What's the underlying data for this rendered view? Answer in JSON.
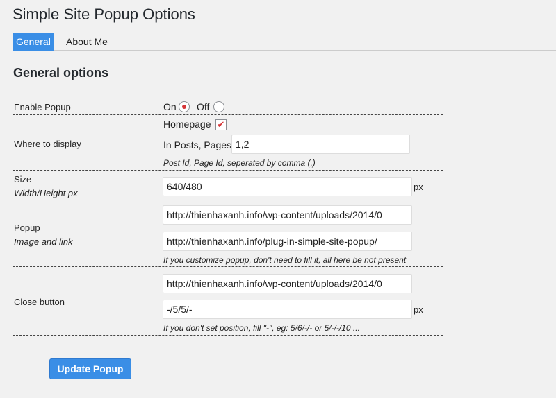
{
  "page": {
    "title": "Simple Site Popup Options"
  },
  "tabs": [
    {
      "label": "General",
      "active": true
    },
    {
      "label": "About Me",
      "active": false
    }
  ],
  "section": {
    "title": "General options"
  },
  "enable_popup": {
    "label": "Enable Popup",
    "on_label": "On",
    "off_label": "Off",
    "selected": "On"
  },
  "where": {
    "label": "Where to display",
    "homepage_label": "Homepage",
    "homepage_checked": true,
    "posts_label": "In Posts, Pages",
    "posts_value": "1,2",
    "note": "Post Id, Page Id, seperated by comma (,)"
  },
  "size": {
    "label": "Size",
    "sublabel": "Width/Height px",
    "value": "640/480",
    "unit": "px"
  },
  "popup": {
    "label": "Popup",
    "sublabel": "Image and link",
    "image_value": "http://thienhaxanh.info/wp-content/uploads/2014/0",
    "link_value": "http://thienhaxanh.info/plug-in-simple-site-popup/",
    "note": "If you customize popup, don't need to fill it, all here be not present"
  },
  "close_button": {
    "label": "Close button",
    "image_value": "http://thienhaxanh.info/wp-content/uploads/2014/0",
    "position_value": "-/5/5/-",
    "unit": "px",
    "note": "If you don't set position, fill \"-\", eg: 5/6/-/- or 5/-/-/10 ..."
  },
  "submit": {
    "label": "Update Popup"
  },
  "colors": {
    "accent": "#3a8ee6",
    "radio_dot": "#d63638",
    "background": "#f1f1f1"
  }
}
